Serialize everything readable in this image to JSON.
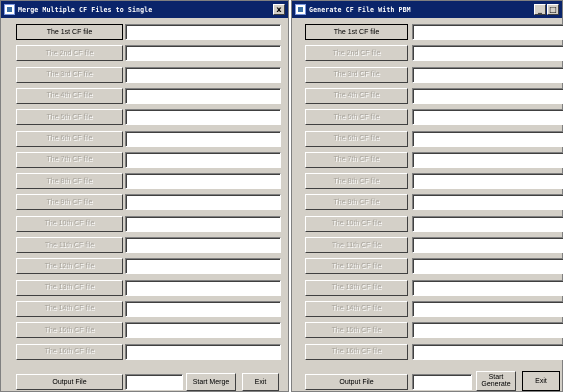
{
  "merge_window": {
    "title": "Merge Multiple CF Files to Single",
    "close_glyph": "x",
    "file_buttons": [
      "The 1st CF file",
      "The 2nd CF file",
      "The 3rd CF file",
      "The 4th CF file",
      "The 5th CF file",
      "The 6th CF file",
      "The 7th CF file",
      "The 8th CF file",
      "The 9th CF file",
      "The 10th CF file",
      "The 11th CF file",
      "The 12th CF file",
      "The 13th CF file",
      "The 14th CF file",
      "The 15th CF file",
      "The 16th CF file"
    ],
    "output_button": "Output File",
    "start_button": "Start Merge",
    "exit_button": "Exit"
  },
  "generate_window": {
    "title": "Generate CF File With PBM",
    "minimize_glyph": "_",
    "maximize_glyph": "□",
    "file_buttons": [
      "The 1st CF file",
      "The 2nd CF file",
      "The 3rd CF file",
      "The 4th CF file",
      "The 5th CF file",
      "The 6th CF file",
      "The 7th CF file",
      "The 8th CF file",
      "The 9th CF file",
      "The 10th CF file",
      "The 11th CF file",
      "The 12th CF file",
      "The 13th CF file",
      "The 14th CF file",
      "The 15th CF file",
      "The 16th CF file"
    ],
    "output_button": "Output File",
    "start_button_line1": "Start",
    "start_button_line2": "Generate",
    "exit_button": "Exit"
  }
}
